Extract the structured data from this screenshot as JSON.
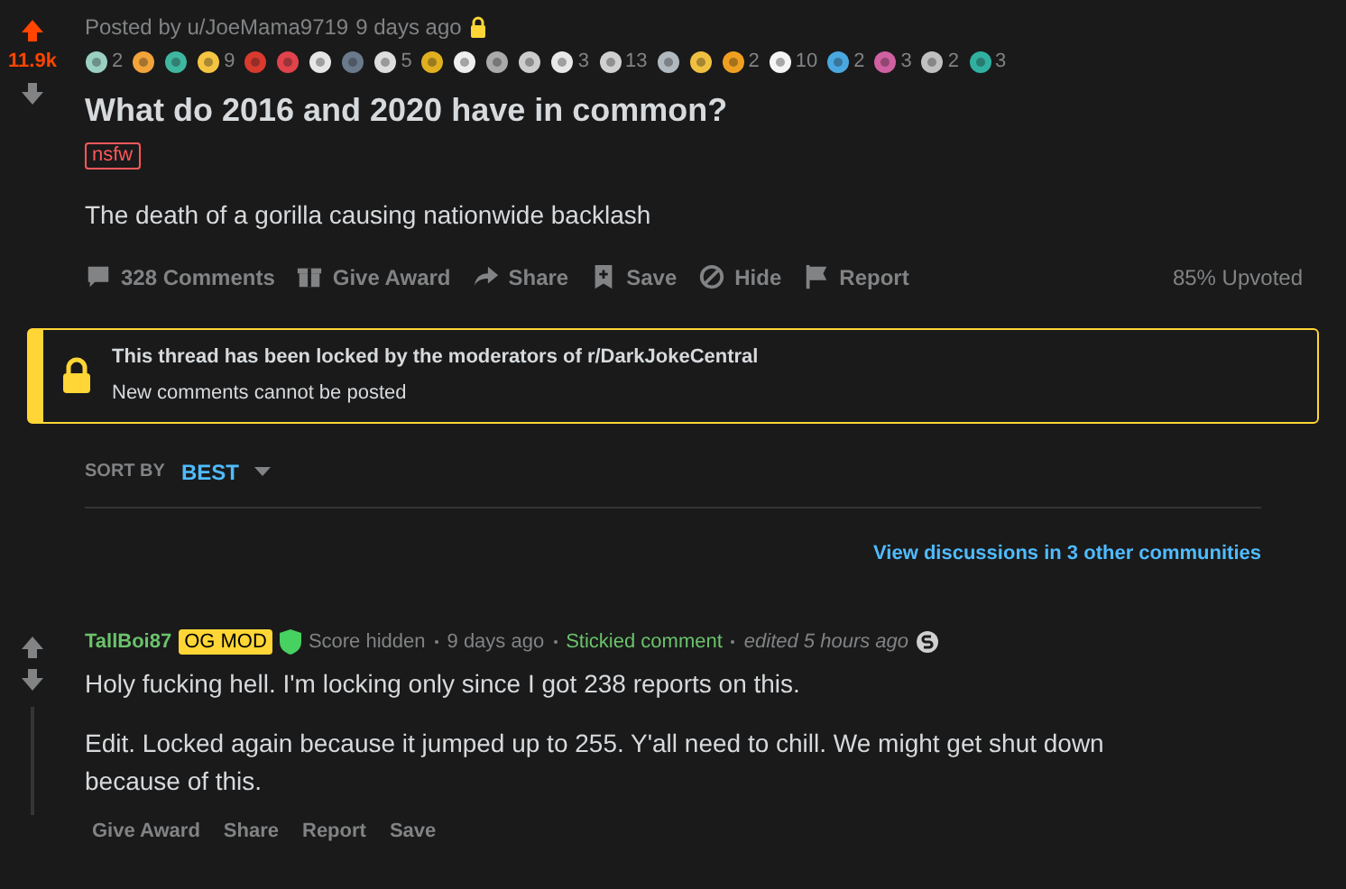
{
  "post": {
    "score": "11.9k",
    "upvoted": true,
    "posted_by": "Posted by u/JoeMama9719",
    "age": "9 days ago",
    "locked": true,
    "awards": [
      {
        "color": "#9ad0c2",
        "count": "2"
      },
      {
        "color": "#f2a33a"
      },
      {
        "color": "#3fb6a0"
      },
      {
        "color": "#f5c542",
        "count": "9"
      },
      {
        "color": "#d83a2e"
      },
      {
        "color": "#e0434b"
      },
      {
        "color": "#e6e6e6"
      },
      {
        "color": "#6a7a8c"
      },
      {
        "color": "#dddddd",
        "count": "5"
      },
      {
        "color": "#e0b020"
      },
      {
        "color": "#eeeeee"
      },
      {
        "color": "#aaaaaa"
      },
      {
        "color": "#cccccc"
      },
      {
        "color": "#e8e8e8",
        "count": "3"
      },
      {
        "color": "#d0d0d0",
        "count": "13"
      },
      {
        "color": "#b0b8c0"
      },
      {
        "color": "#f0c040"
      },
      {
        "color": "#f0a020",
        "count": "2"
      },
      {
        "color": "#f5f5f5",
        "count": "10"
      },
      {
        "color": "#4aa8e0",
        "count": "2"
      },
      {
        "color": "#d060a0",
        "count": "3"
      },
      {
        "color": "#c0c0c0",
        "count": "2"
      },
      {
        "color": "#30b0a0",
        "count": "3"
      }
    ],
    "title": "What do 2016 and 2020 have in common?",
    "tag": "nsfw",
    "body": "The death of a gorilla causing nationwide backlash",
    "actions": [
      {
        "kind": "comments",
        "label": "328 Comments"
      },
      {
        "kind": "award",
        "label": "Give Award"
      },
      {
        "kind": "share",
        "label": "Share"
      },
      {
        "kind": "save",
        "label": "Save"
      },
      {
        "kind": "hide",
        "label": "Hide"
      },
      {
        "kind": "report",
        "label": "Report"
      }
    ],
    "upvoted_ratio": "85% Upvoted"
  },
  "lock_notice": {
    "title": "This thread has been locked by the moderators of r/DarkJokeCentral",
    "subtitle": "New comments cannot be posted"
  },
  "sort": {
    "label": "SORT BY",
    "value": "BEST"
  },
  "other_discussions": "View discussions in 3 other communities",
  "comment": {
    "author": "TallBoi87",
    "flair": "OG MOD",
    "score": "Score hidden",
    "age": "9 days ago",
    "stickied": "Stickied comment",
    "edited": "edited 5 hours ago",
    "paragraphs": [
      "Holy fucking hell. I'm locking only since I got 238 reports on this.",
      "Edit. Locked again because it jumped up to 255. Y'all need to chill. We might get shut down because of this."
    ],
    "actions": [
      "Give Award",
      "Share",
      "Report",
      "Save"
    ]
  }
}
